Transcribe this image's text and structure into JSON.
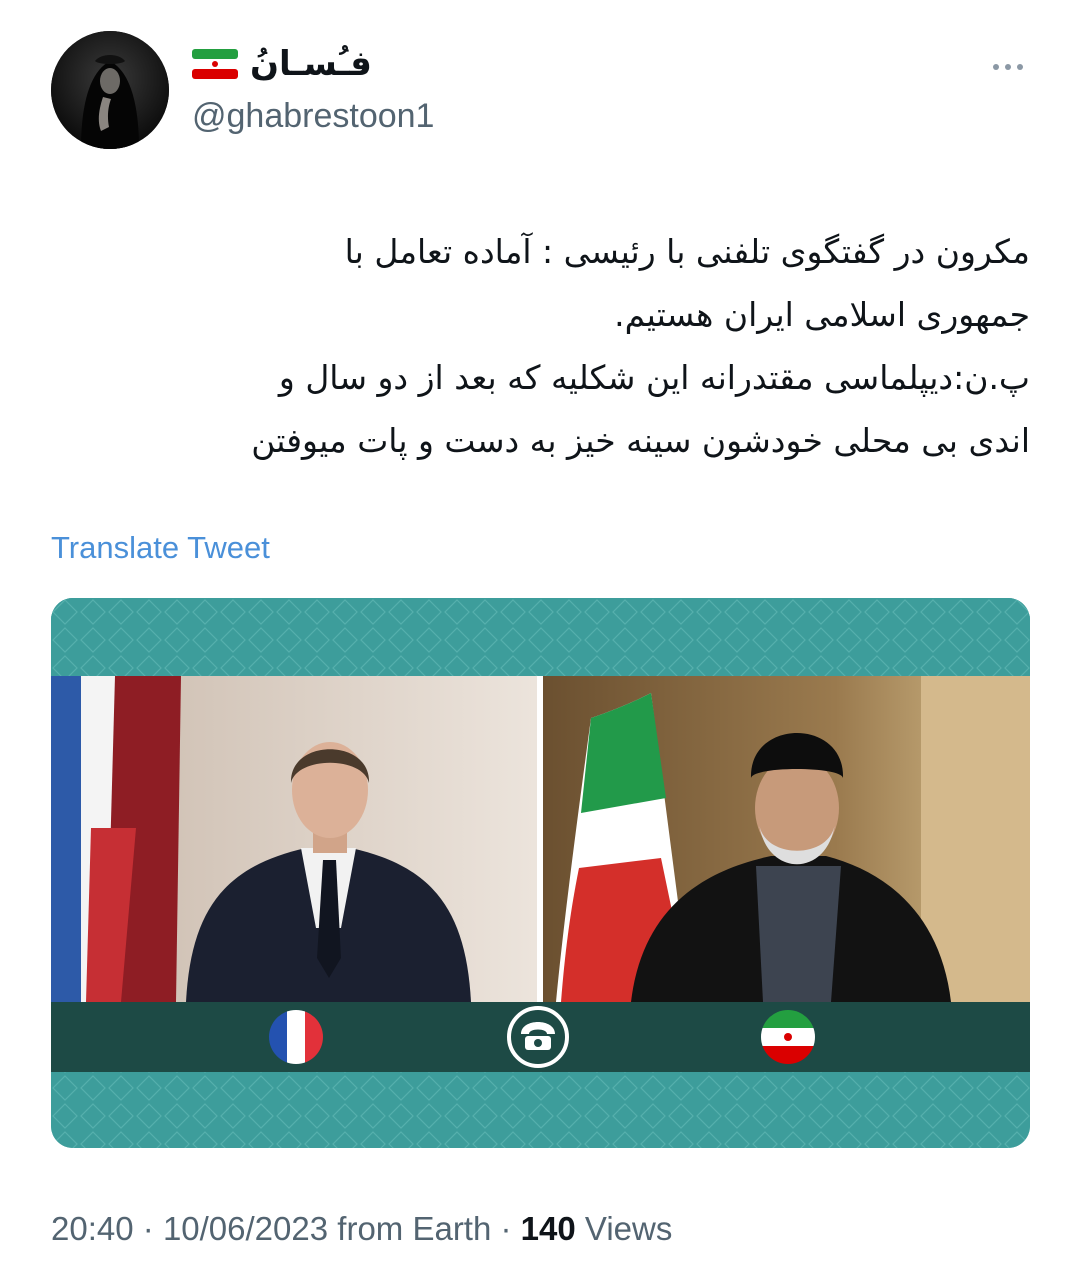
{
  "author": {
    "display_name": "فـُسـانُ",
    "handle": "@ghabrestoon1",
    "flag_icon": "iran-flag-icon"
  },
  "tweet": {
    "lines": [
      "مکرون در گفتگوی تلفنی با رئیسی : آماده تعامل با",
      "جمهوری اسلامی ایران هستیم.",
      "پ.ن:دیپلماسی مقتدرانه این شکلیه که بعد از دو سال و",
      "اندی بی محلی خودشون سینه خیز به دست و پات میوفتن"
    ],
    "translate_label": "Translate Tweet"
  },
  "meta": {
    "time": "20:40",
    "date": "10/06/2023",
    "source": "from Earth",
    "views_count": "140",
    "views_label": "Views",
    "separator": "·"
  },
  "colors": {
    "link": "#4a90d9",
    "muted": "#536471",
    "media_teal": "#3b9a98",
    "media_band": "#1d4a45"
  }
}
